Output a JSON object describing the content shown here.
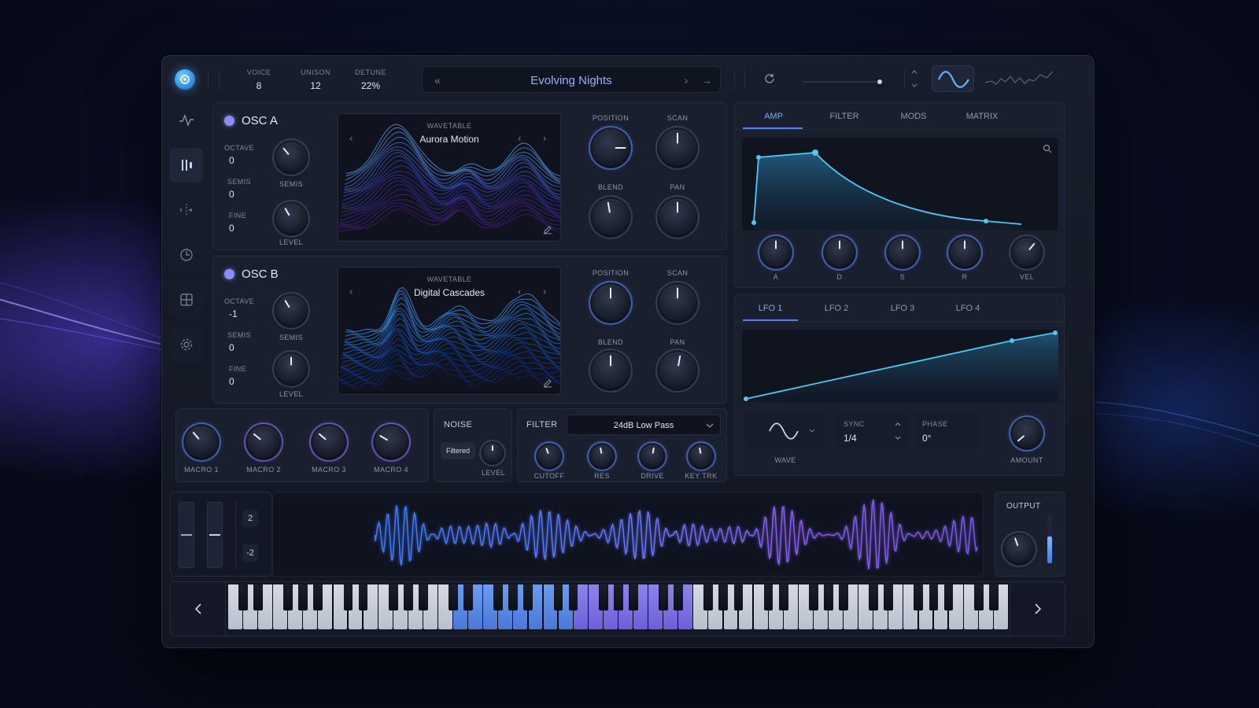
{
  "app": {
    "preset_name": "Evolving Nights",
    "stats": [
      {
        "label": "VOICE",
        "value": "8"
      },
      {
        "label": "UNISON",
        "value": "12"
      },
      {
        "label": "DETUNE",
        "value": "22%"
      }
    ]
  },
  "osc_a": {
    "title": "OSC A",
    "octave_label": "OCTAVE",
    "octave": "0",
    "semis_label": "SEMIS",
    "semis": "0",
    "fine_label": "FINE",
    "fine": "0",
    "semis_knob_label": "SEMIS",
    "level_knob_label": "LEVEL",
    "wavetable_label": "WAVETABLE",
    "wavetable_name": "Aurora Motion",
    "position_label": "POSITION",
    "scan_label": "SCAN",
    "blend_label": "BLEND",
    "pan_label": "PAN"
  },
  "osc_b": {
    "title": "OSC B",
    "octave_label": "OCTAVE",
    "octave": "-1",
    "semis_label": "SEMIS",
    "semis": "0",
    "fine_label": "FINE",
    "fine": "0",
    "semis_knob_label": "SEMIS",
    "level_knob_label": "LEVEL",
    "wavetable_label": "WAVETABLE",
    "wavetable_name": "Digital Cascades",
    "position_label": "POSITION",
    "scan_label": "SCAN",
    "blend_label": "BLEND",
    "pan_label": "PAN"
  },
  "macros": [
    "MACRO 1",
    "MACRO 2",
    "MACRO 3",
    "MACRO 4"
  ],
  "noise": {
    "title": "NOISE",
    "mode": "Filtered",
    "level_label": "LEVEL"
  },
  "filter": {
    "title": "FILTER",
    "type": "24dB Low Pass",
    "knobs": [
      "CUTOFF",
      "RES",
      "DRIVE",
      "KEY TRK"
    ]
  },
  "env_tabs": [
    "AMP",
    "FILTER",
    "MODS",
    "MATRIX"
  ],
  "env_knobs": [
    "A",
    "D",
    "S",
    "R",
    "VEL"
  ],
  "lfo_tabs": [
    "LFO 1",
    "LFO 2",
    "LFO 3",
    "LFO 4"
  ],
  "lfo": {
    "wave_label": "WAVE",
    "sync_label": "SYNC",
    "sync_value": "1/4",
    "phase_label": "PHASE",
    "phase_value": "0°",
    "amount_label": "AMOUNT"
  },
  "pitch": {
    "up": "2",
    "down": "-2"
  },
  "output": {
    "label": "OUTPUT",
    "level": 0.55
  },
  "colors": {
    "accent_blue": "#4d8dff",
    "accent_purple": "#8a6cf0",
    "curve_cyan": "#3cc4ee",
    "panel_bg": "#1a1f2e"
  },
  "icons": {
    "sidebar": [
      "oscillator-wave-icon",
      "mixer-bars-icon",
      "split-icon",
      "clock-icon",
      "grid-icon",
      "gear-icon"
    ]
  }
}
